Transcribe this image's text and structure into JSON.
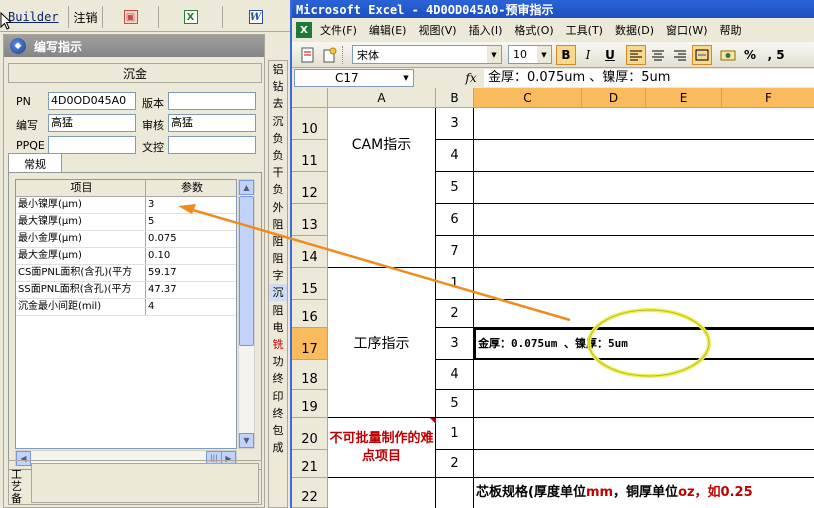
{
  "left_app": {
    "builder_tab": "Builder",
    "logout_label": "注销",
    "ppt_icon": "powerpoint-icon",
    "xls_icon": "excel-icon",
    "doc_icon": "word-icon",
    "panel_title": "编写指示",
    "panel_subtitle": "沉金",
    "fields": {
      "pn_label": "PN",
      "pn_value": "4D0OD045A0",
      "version_label": "版本",
      "version_value": "",
      "author_label": "编写",
      "author_value": "高猛",
      "reviewer_label": "审核",
      "reviewer_value": "高猛",
      "ppqe_label": "PPQE",
      "ppqe_value": "",
      "docctrl_label": "文控",
      "docctrl_value": ""
    },
    "tab_label": "常规",
    "grid_headers": [
      "项目",
      "参数"
    ],
    "grid_rows": [
      {
        "item": "最小镍厚(μm)",
        "value": "3"
      },
      {
        "item": "最大镍厚(μm)",
        "value": "5"
      },
      {
        "item": "最小金厚(μm)",
        "value": "0.075"
      },
      {
        "item": "最大金厚(μm)",
        "value": "0.10"
      },
      {
        "item": "CS面PNL面积(含孔)(平方",
        "value": "59.17"
      },
      {
        "item": "SS面PNL面积(含孔)(平方",
        "value": "47.37"
      },
      {
        "item": "沉金最小间距(mil)",
        "value": "4"
      }
    ],
    "bottom_label": "工艺备"
  },
  "side_strip": [
    "铝",
    "钻",
    "去",
    "沉",
    "负",
    "负",
    "干",
    "负",
    "外",
    "阻",
    "阻",
    "阻",
    "字",
    "沉",
    "阻",
    "电",
    "铣",
    "功",
    "终",
    "印",
    "终",
    "包",
    "成"
  ],
  "excel": {
    "title": "Microsoft Excel - 4D0OD045A0-预审指示",
    "menus": [
      "文件(F)",
      "编辑(E)",
      "视图(V)",
      "插入(I)",
      "格式(O)",
      "工具(T)",
      "数据(D)",
      "窗口(W)",
      "帮助"
    ],
    "font_name": "宋体",
    "font_size": "10",
    "bold": "B",
    "italic": "I",
    "underline": "U",
    "percent": "%",
    "comma": ", 5",
    "name_box": "C17",
    "fx": "fx",
    "formula": "金厚：0.075um 、镍厚：5um",
    "columns": [
      "A",
      "B",
      "C",
      "D",
      "E",
      "F"
    ],
    "rows": [
      {
        "num": "10",
        "b": "3"
      },
      {
        "num": "11",
        "b": "4"
      },
      {
        "num": "12",
        "b": "5"
      },
      {
        "num": "13",
        "b": "6"
      },
      {
        "num": "14",
        "b": "7"
      },
      {
        "num": "15",
        "b": "1"
      },
      {
        "num": "16",
        "b": "2"
      },
      {
        "num": "17",
        "b": "3"
      },
      {
        "num": "18",
        "b": "4"
      },
      {
        "num": "19",
        "b": "5"
      },
      {
        "num": "20",
        "b": "1"
      },
      {
        "num": "21",
        "b": "2"
      },
      {
        "num": "22",
        "b": ""
      }
    ],
    "stage_cam": "CAM指示",
    "stage_process": "工序指示",
    "stage_difficult": "不可批量制作的难点项目",
    "c17": "金厚：0.075um 、镍厚：5um",
    "c22_a": "芯板规格(厚度单位",
    "c22_mm": "mm",
    "c22_b": "，铜厚单位",
    "c22_oz": "oz，如0.25"
  },
  "colors": {
    "excel_title_bar": "#2b64d8",
    "selected_header": "#f9bb5e",
    "annotation_arrow": "#f08c1e",
    "annotation_ellipse": "#f0f050",
    "red_text": "#c00000"
  }
}
